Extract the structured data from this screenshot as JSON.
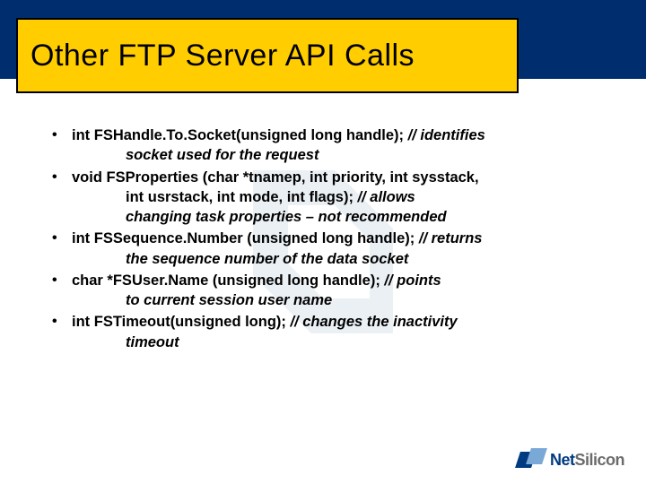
{
  "slide": {
    "title": "Other FTP Server API Calls"
  },
  "bullets": [
    {
      "line1": "int FSHandle.To.Socket(unsigned long handle);  ",
      "comment1": "// identifies",
      "line2": "socket used for the request"
    },
    {
      "line1": "void FSProperties (char *tnamep, int priority, int sysstack,",
      "line2a": "int usrstack, int mode, int flags);        ",
      "comment2a": "//  allows",
      "line2b": "changing task properties – not recommended"
    },
    {
      "line1": "int FSSequence.Number (unsigned long handle);   ",
      "comment1": "//  returns",
      "line2": "the sequence number of the data socket"
    },
    {
      "line1": "char *FSUser.Name (unsigned long handle);               ",
      "comment1": "// points",
      "line2": "to current session user name"
    },
    {
      "line1": "int FSTimeout(unsigned long);         ",
      "comment1": "//  changes the inactivity",
      "line2": "timeout"
    }
  ],
  "brand": {
    "name1": "Net",
    "name2": "Silicon"
  }
}
